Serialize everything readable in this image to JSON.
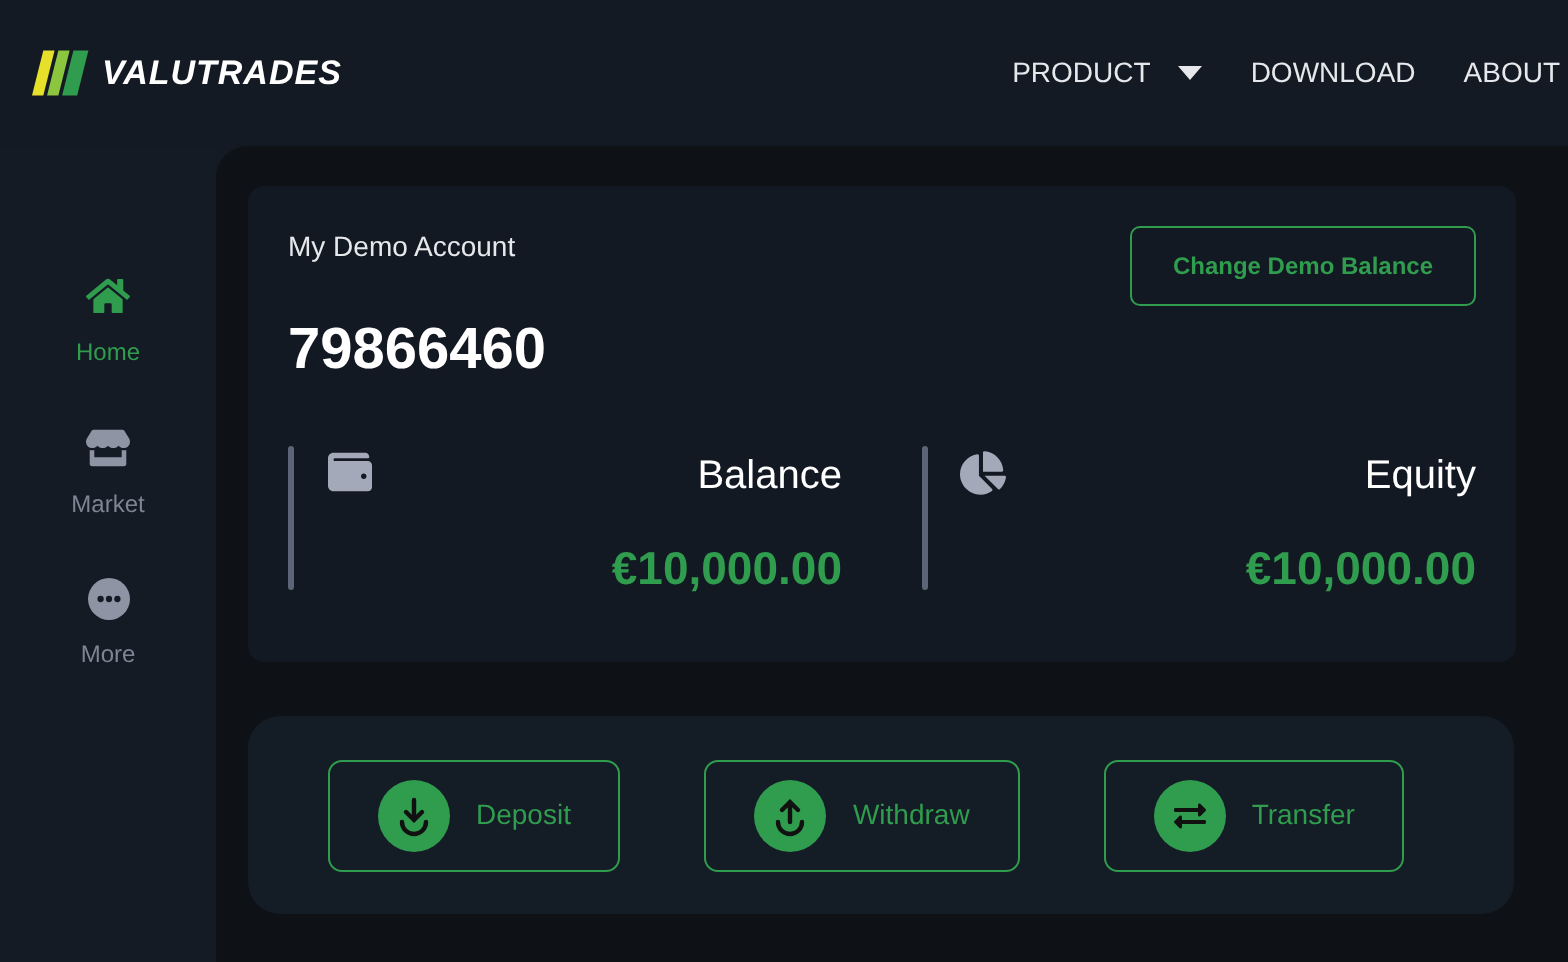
{
  "header": {
    "logo": "VALUTRADES",
    "nav": [
      {
        "label": "PRODUCT",
        "kind": "dropdown"
      },
      {
        "label": "DOWNLOAD",
        "kind": "link"
      },
      {
        "label": "ABOUT",
        "kind": "link"
      }
    ]
  },
  "sidebar": {
    "items": [
      {
        "label": "Home",
        "selected": true
      },
      {
        "label": "Market",
        "selected": false
      },
      {
        "label": "More",
        "selected": false
      }
    ]
  },
  "account": {
    "title": "My Demo Account",
    "number": "79866460",
    "button": "Change Demo Balance",
    "stats": [
      {
        "label": "Balance",
        "value": "€10,000.00"
      },
      {
        "label": "Equity",
        "value": "€10,000.00"
      }
    ]
  },
  "actions": [
    {
      "label": "Deposit"
    },
    {
      "label": "Withdraw"
    },
    {
      "label": "Transfer"
    }
  ]
}
